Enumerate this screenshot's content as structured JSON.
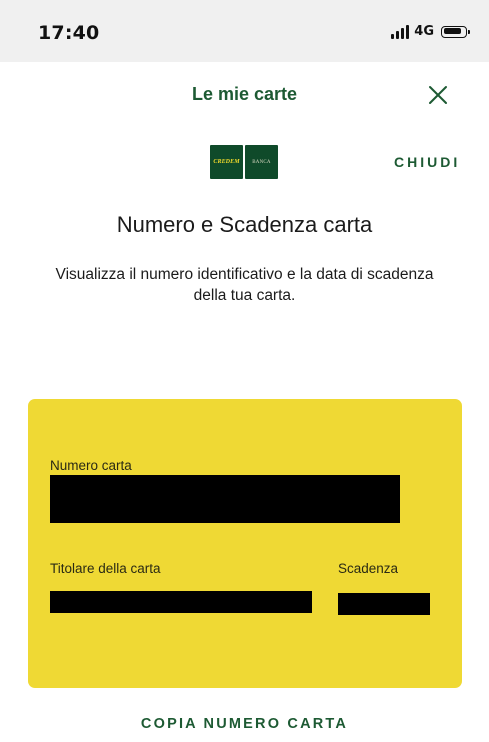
{
  "status_bar": {
    "time": "17:40",
    "network": "4G",
    "signal_icon": "signal-bars-icon",
    "battery_icon": "battery-icon"
  },
  "header": {
    "title": "Le mie carte",
    "close_icon": "close-x-icon"
  },
  "logo": {
    "brand": "CREDEM",
    "sub": "BANCA"
  },
  "close_link": "CHIUDI",
  "section": {
    "title": "Numero e Scadenza carta",
    "description": "Visualizza il numero identificativo e la data di scadenza della tua carta."
  },
  "card": {
    "number_label": "Numero carta",
    "holder_label": "Titolare della carta",
    "expiry_label": "Scadenza"
  },
  "copy_button": "COPIA NUMERO CARTA",
  "colors": {
    "accent": "#1d5a33",
    "card": "#efd934",
    "logo": "#0f4a2a",
    "status_bar": "#f0f0f0"
  }
}
